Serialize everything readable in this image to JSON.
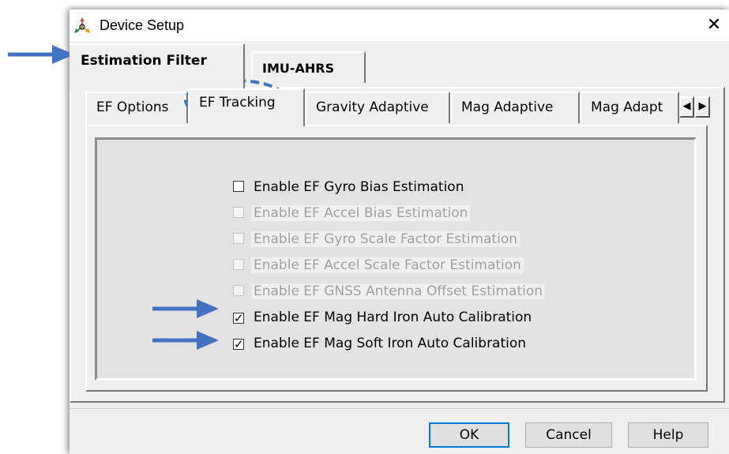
{
  "window": {
    "title": "Device Setup",
    "close_glyph": "✕"
  },
  "main_tabs": [
    {
      "label": "Estimation Filter",
      "active": true
    },
    {
      "label": "IMU-AHRS",
      "active": false
    }
  ],
  "sub_tabs": [
    {
      "label": "EF Options",
      "active": false
    },
    {
      "label": "EF Tracking",
      "active": true
    },
    {
      "label": "Gravity Adaptive",
      "active": false
    },
    {
      "label": "Mag Adaptive",
      "active": false
    },
    {
      "label": "Mag Adapt",
      "active": false
    }
  ],
  "tab_scroll": {
    "left": "◀",
    "right": "▶"
  },
  "options": [
    {
      "label": "Enable EF Gyro Bias Estimation",
      "checked": false,
      "enabled": true,
      "mark": ""
    },
    {
      "label": "Enable EF Accel Bias Estimation",
      "checked": false,
      "enabled": false,
      "mark": ""
    },
    {
      "label": "Enable EF Gyro Scale Factor Estimation",
      "checked": false,
      "enabled": false,
      "mark": ""
    },
    {
      "label": "Enable EF Accel Scale Factor Estimation",
      "checked": false,
      "enabled": false,
      "mark": ""
    },
    {
      "label": "Enable EF GNSS Antenna Offset Estimation",
      "checked": false,
      "enabled": false,
      "mark": ""
    },
    {
      "label": "Enable EF Mag Hard Iron Auto Calibration",
      "checked": true,
      "enabled": true,
      "mark": "✓"
    },
    {
      "label": "Enable EF Mag Soft Iron Auto Calibration",
      "checked": true,
      "enabled": true,
      "mark": "✓"
    }
  ],
  "buttons": {
    "ok": "OK",
    "cancel": "Cancel",
    "help": "Help"
  },
  "colors": {
    "annotation": "#4472c4",
    "focus_border": "#0078d7",
    "disabled_text": "#a0a0a0"
  },
  "icons": [
    "app-icon",
    "close-icon",
    "scroll-left-icon",
    "scroll-right-icon",
    "checkmark-icon",
    "arrow-annotation-icon"
  ]
}
